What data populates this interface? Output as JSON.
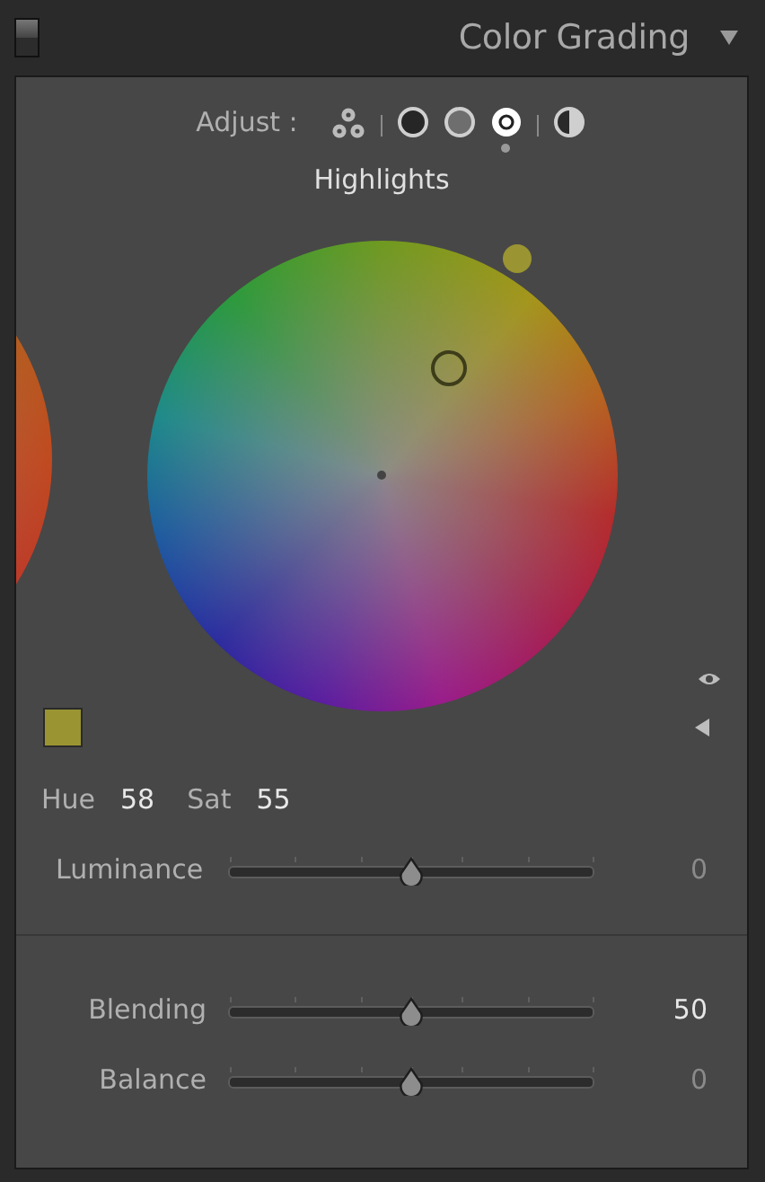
{
  "panel": {
    "title": "Color Grading",
    "expanded": true
  },
  "adjust": {
    "label": "Adjust :",
    "modes": [
      {
        "kind": "three",
        "selected": false
      },
      {
        "kind": "shadows",
        "selected": false
      },
      {
        "kind": "midtones",
        "selected": false
      },
      {
        "kind": "highlights",
        "selected": true
      },
      {
        "kind": "global",
        "selected": false
      }
    ],
    "mode_title": "Highlights"
  },
  "wheel": {
    "color": "#9a9432"
  },
  "hue": {
    "label": "Hue",
    "value": "58"
  },
  "sat": {
    "label": "Sat",
    "value": "55"
  },
  "sliders": [
    {
      "label": "Luminance",
      "value": "0",
      "level": 0.5,
      "dimmed": true
    },
    {
      "label": "Blending",
      "value": "50",
      "level": 0.5,
      "dimmed": false
    },
    {
      "label": "Balance",
      "value": "0",
      "level": 0.5,
      "dimmed": true
    }
  ]
}
